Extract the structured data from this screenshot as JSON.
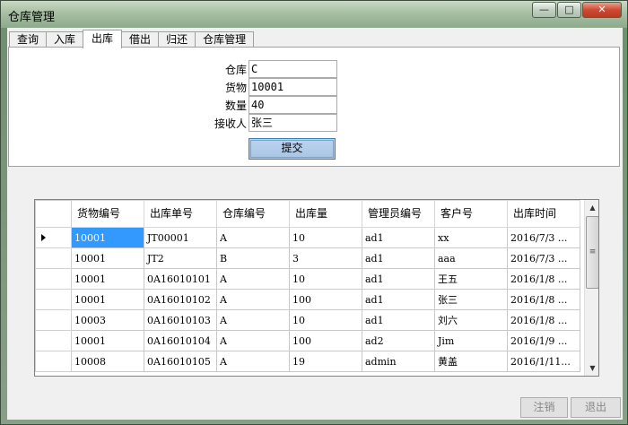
{
  "window": {
    "title": "仓库管理",
    "minimize": "—",
    "maximize": "□",
    "close": "✕"
  },
  "tabs": [
    "查询",
    "入库",
    "出库",
    "借出",
    "归还",
    "仓库管理"
  ],
  "form": {
    "warehouse_label": "仓库",
    "warehouse_value": "C",
    "goods_label": "货物",
    "goods_value": "10001",
    "quantity_label": "数量",
    "quantity_value": "40",
    "receiver_label": "接收人",
    "receiver_value": "张三",
    "submit_label": "提交"
  },
  "grid": {
    "columns": [
      "货物编号",
      "出库单号",
      "仓库编号",
      "出库量",
      "管理员编号",
      "客户号",
      "出库时间"
    ],
    "rows": [
      [
        "10001",
        "JT00001",
        "A",
        "10",
        "ad1",
        "xx",
        "2016/7/3 ..."
      ],
      [
        "10001",
        "JT2",
        "B",
        "3",
        "ad1",
        "aaa",
        "2016/7/3 ..."
      ],
      [
        "10001",
        "0A16010101",
        "A",
        "10",
        "ad1",
        "王五",
        "2016/1/8 ..."
      ],
      [
        "10001",
        "0A16010102",
        "A",
        "100",
        "ad1",
        "张三",
        "2016/1/8 ..."
      ],
      [
        "10003",
        "0A16010103",
        "A",
        "10",
        "ad1",
        "刘六",
        "2016/1/8 ..."
      ],
      [
        "10001",
        "0A16010104",
        "A",
        "100",
        "ad2",
        "Jim",
        "2016/1/9 ..."
      ],
      [
        "10008",
        "0A16010105",
        "A",
        "19",
        "admin",
        "黄盖",
        "2016/1/11..."
      ]
    ]
  },
  "buttons": {
    "logout_label": "注销",
    "exit_label": "退出"
  }
}
